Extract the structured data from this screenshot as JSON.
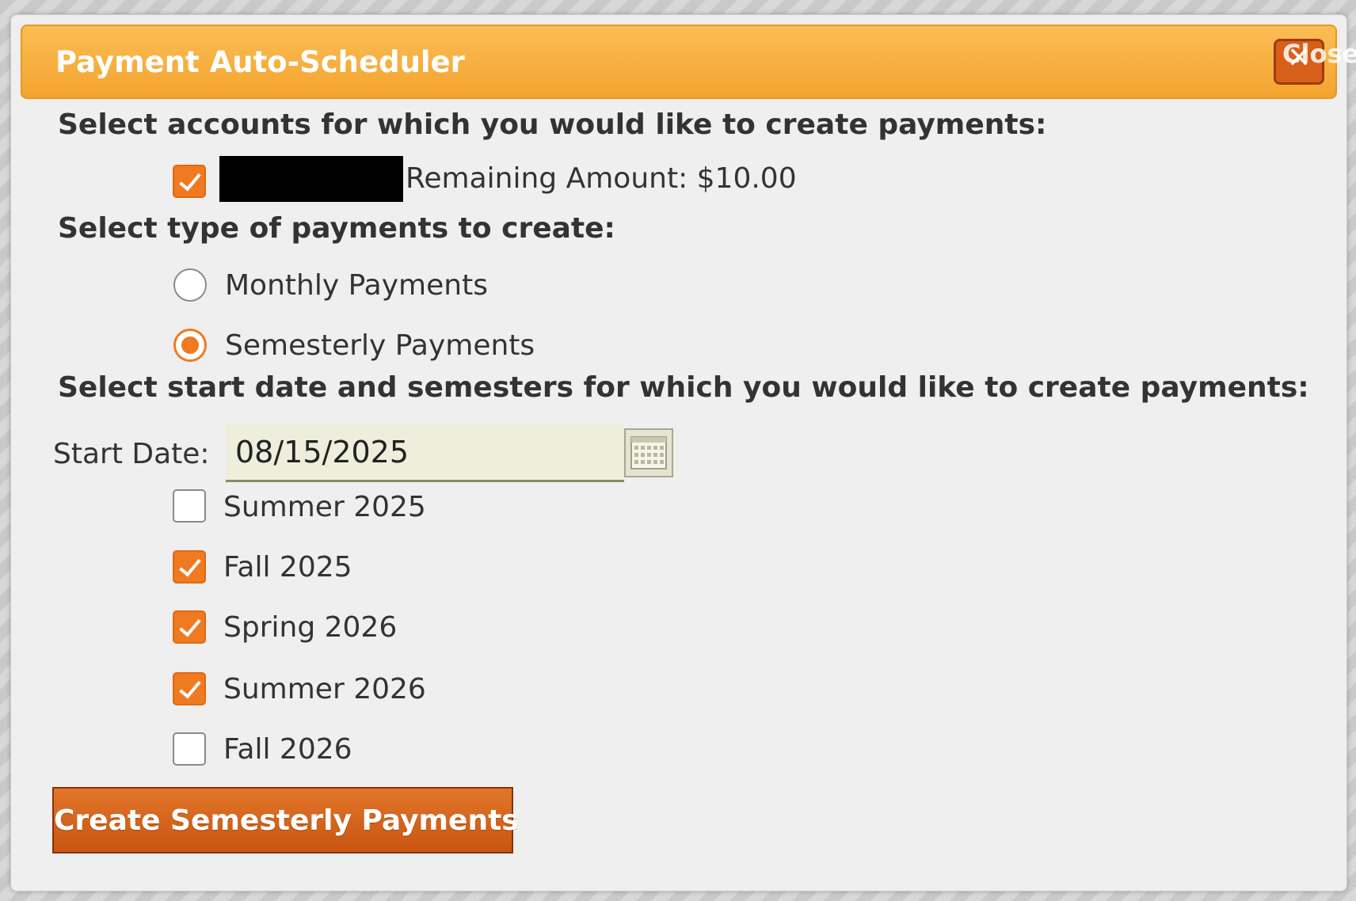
{
  "dialog": {
    "title": "Payment Auto-Scheduler",
    "close_label": "Close"
  },
  "accounts": {
    "heading": "Select accounts for which you would like to create payments:",
    "items": [
      {
        "checked": true,
        "remaining": "Remaining Amount: $10.00"
      }
    ]
  },
  "payment_type": {
    "heading": "Select type of payments to create:",
    "options": [
      {
        "label": "Monthly Payments",
        "selected": false
      },
      {
        "label": "Semesterly Payments",
        "selected": true
      }
    ]
  },
  "schedule": {
    "heading": "Select start date and semesters for which you would like to create payments:",
    "start_date_label": "Start Date:",
    "start_date_value": "08/15/2025",
    "semesters": [
      {
        "label": "Summer 2025",
        "checked": false
      },
      {
        "label": "Fall 2025",
        "checked": true
      },
      {
        "label": "Spring 2026",
        "checked": true
      },
      {
        "label": "Summer 2026",
        "checked": true
      },
      {
        "label": "Fall 2026",
        "checked": false
      }
    ]
  },
  "actions": {
    "create_label": "Create Semesterly Payments"
  },
  "colors": {
    "accent": "#f07a22",
    "titlebar": "#f4a42e",
    "button": "#d0621a"
  }
}
